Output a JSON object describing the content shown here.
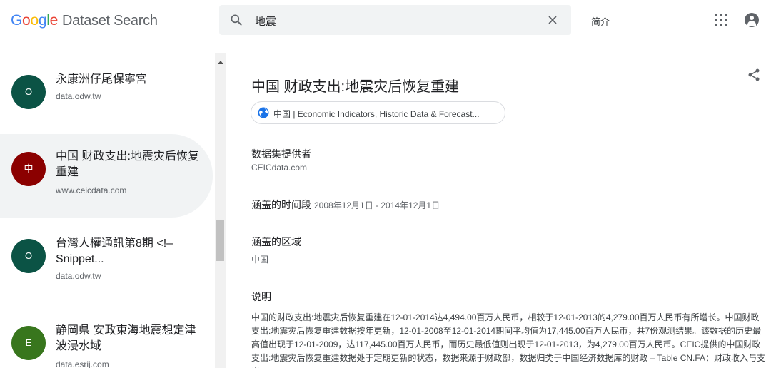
{
  "header": {
    "logo_letters": [
      "G",
      "o",
      "o",
      "g",
      "l",
      "e"
    ],
    "logo_suffix": "Dataset Search",
    "search_value": "地震",
    "about_label": "简介",
    "apps_icon": "apps-grid-icon",
    "account_icon": "account-icon"
  },
  "results": [
    {
      "avatar": "O",
      "avatar_color": "#0b5345",
      "title": "永康洲仔尾保寧宮",
      "source": "data.odw.tw"
    },
    {
      "avatar": "中",
      "avatar_color": "#8b0000",
      "title": "中国 财政支出:地震灾后恢复重建",
      "source": "www.ceicdata.com"
    },
    {
      "avatar": "O",
      "avatar_color": "#0b5345",
      "title": "台灣人權通訊第8期 <!– Snippet...",
      "source": "data.odw.tw"
    },
    {
      "avatar": "E",
      "avatar_color": "#38761d",
      "title": "静岡県 安政東海地震想定津波浸水域",
      "source": "data.esrij.com"
    }
  ],
  "detail": {
    "title": "中国 财政支出:地震灾后恢复重建",
    "chip": "中国 | Economic Indicators, Historic Data & Forecast...",
    "provider_label": "数据集提供者",
    "provider_value": "CEICdata.com",
    "period_label": "涵盖的时间段",
    "period_value": "2008年12月1日  -  2014年12月1日",
    "region_label": "涵盖的区域",
    "region_value": "中国",
    "desc_label": "说明",
    "description": "中国的财政支出:地震灾后恢复重建在12-01-2014达4,494.00百万人民币，相较于12-01-2013的4,279.00百万人民币有所增长。中国财政支出:地震灾后恢复重建数据按年更新，12-01-2008至12-01-2014期间平均值为17,445.00百万人民币，共7份观测结果。该数据的历史最高值出现于12-01-2009，达117,445.00百万人民币，而历史最低值则出现于12-01-2013，为4,279.00百万人民币。CEIC提供的中国财政支出:地震灾后恢复重建数据处于定期更新的状态，数据来源于财政部，数据归类于中国经济数据库的财政 – Table CN.FA：财政收入与支出。"
  },
  "colors": {
    "accent": "#1a73e8",
    "selected_bg": "#f1f3f4"
  }
}
